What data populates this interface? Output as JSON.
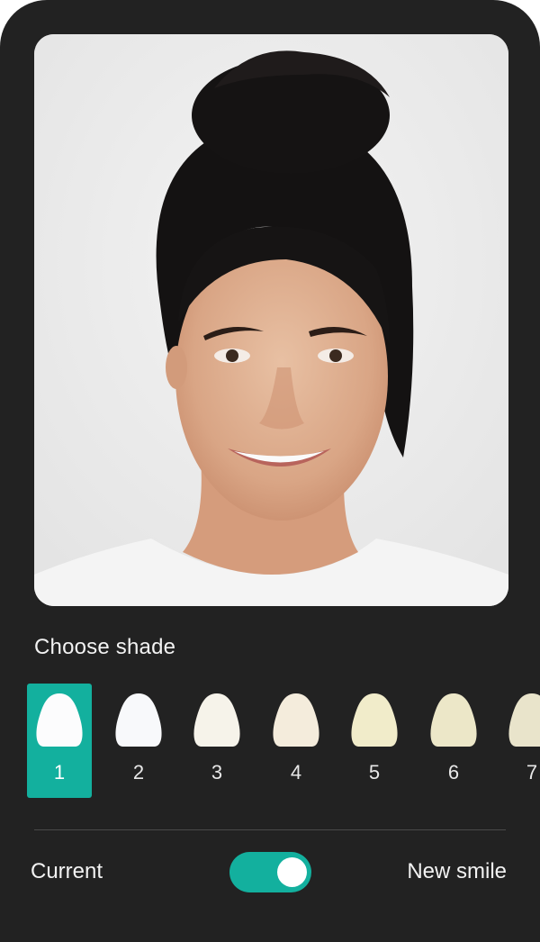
{
  "preview": {
    "photo_description_icon": "portrait-photo"
  },
  "shade_section": {
    "title": "Choose shade",
    "selected_index": 0,
    "shades": [
      {
        "label": "1",
        "color": "#fcfcfd"
      },
      {
        "label": "2",
        "color": "#f8f9fb"
      },
      {
        "label": "3",
        "color": "#f6f3ea"
      },
      {
        "label": "4",
        "color": "#f4ecdc"
      },
      {
        "label": "5",
        "color": "#f1ecca"
      },
      {
        "label": "6",
        "color": "#ece7c8"
      },
      {
        "label": "7",
        "color": "#e9e4cb"
      }
    ]
  },
  "comparison": {
    "left_label": "Current",
    "right_label": "New smile",
    "toggle_on": true,
    "accent_color": "#13b09e"
  }
}
